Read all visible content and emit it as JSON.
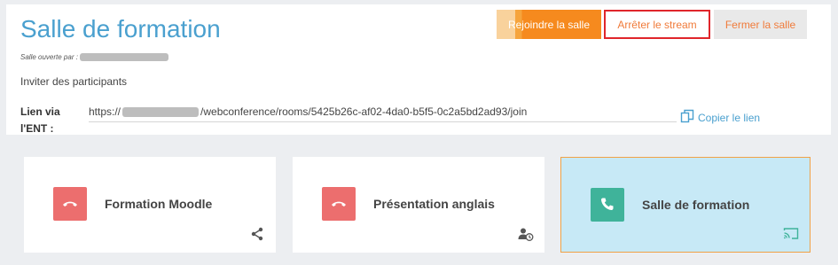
{
  "header": {
    "title": "Salle de formation",
    "opened_by_label": "Salle ouverte par :",
    "invite_label": "Invider des participants",
    "link_label": "Lien via l'ENT :",
    "link_prefix": "https://",
    "link_suffix": "/webconference/rooms/5425b26c-af02-4da0-b5f5-0c2a5bd2ad93/join",
    "copy_link_label": "Copier le lien"
  },
  "actions": {
    "join_label": "Rejoindre la salle",
    "stop_stream_label": "Arrêter le stream",
    "close_label": "Fermer la salle"
  },
  "rooms": [
    {
      "title": "Formation Moodle",
      "status": "inactive",
      "icon": "phone-hangup-icon",
      "corner_icon": "share-icon"
    },
    {
      "title": "Présentation anglais",
      "status": "inactive",
      "icon": "phone-hangup-icon",
      "corner_icon": "user-clock-icon"
    },
    {
      "title": "Salle de formation",
      "status": "active",
      "icon": "phone-icon",
      "corner_icon": "cast-icon"
    }
  ],
  "colors": {
    "accent": "#4aa0cf",
    "join_orange": "#f68a1e",
    "hangup_red": "#ec6e6e",
    "active_green": "#3fb39a",
    "highlight_border": "#e0262b"
  }
}
